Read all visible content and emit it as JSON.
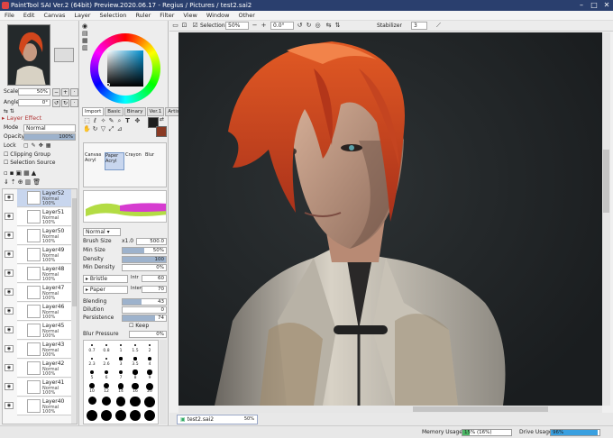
{
  "window": {
    "title": "PaintTool SAI Ver.2 (64bit) Preview.2020.06.17 - Regius / Pictures / test2.sai2"
  },
  "menu": [
    "File",
    "Edit",
    "Canvas",
    "Layer",
    "Selection",
    "Ruler",
    "Filter",
    "View",
    "Window",
    "Other"
  ],
  "navigator": {
    "scale_label": "Scale",
    "scale_value": "50%",
    "angle_label": "Angle",
    "angle_value": "0°"
  },
  "layer_effect": {
    "header": "Layer Effect",
    "mode_label": "Mode",
    "mode_value": "Normal",
    "opacity_label": "Opacity",
    "opacity_value": "100%",
    "lock_label": "Lock",
    "clipping_label": "Clipping Group",
    "selection_source_label": "Selection Source"
  },
  "layers": [
    {
      "name": "Layer52",
      "mode": "Normal",
      "opacity": "100%",
      "selected": true
    },
    {
      "name": "Layer51",
      "mode": "Normal",
      "opacity": "100%",
      "selected": false
    },
    {
      "name": "Layer50",
      "mode": "Normal",
      "opacity": "100%",
      "selected": false
    },
    {
      "name": "Layer49",
      "mode": "Normal",
      "opacity": "100%",
      "selected": false
    },
    {
      "name": "Layer48",
      "mode": "Normal",
      "opacity": "100%",
      "selected": false
    },
    {
      "name": "Layer47",
      "mode": "Normal",
      "opacity": "100%",
      "selected": false
    },
    {
      "name": "Layer46",
      "mode": "Normal",
      "opacity": "100%",
      "selected": false
    },
    {
      "name": "Layer45",
      "mode": "Normal",
      "opacity": "100%",
      "selected": false
    },
    {
      "name": "Layer43",
      "mode": "Normal",
      "opacity": "100%",
      "selected": false
    },
    {
      "name": "Layer42",
      "mode": "Normal",
      "opacity": "100%",
      "selected": false
    },
    {
      "name": "Layer41",
      "mode": "Normal",
      "opacity": "100%",
      "selected": false
    },
    {
      "name": "Layer40",
      "mode": "Normal",
      "opacity": "100%",
      "selected": false
    }
  ],
  "color": {
    "primary": "#1e1e1e",
    "secondary": "#8a3a24",
    "tabs": [
      "Import",
      "Basic",
      "Binary",
      "Ver.1",
      "Artistic"
    ]
  },
  "tools": [
    {
      "name": "Canvas Acryl",
      "label": "Canvas\nAcryl"
    },
    {
      "name": "Paper Acryl",
      "label": "Paper\nAcryl"
    },
    {
      "name": "Crayon",
      "label": "Crayon"
    },
    {
      "name": "Blur",
      "label": "Blur"
    }
  ],
  "brush": {
    "mode": "Normal",
    "size_label": "Brush Size",
    "size_multiplier": "x1.0",
    "size_value": "500.0",
    "min_size_label": "Min Size",
    "min_size_value": "50%",
    "density_label": "Density",
    "density_value": "100",
    "min_density_label": "Min Density",
    "min_density_value": "0%",
    "texture1_label": "Bristle",
    "texture1_sub": "Intr",
    "texture1_value": "60",
    "texture2_label": "Paper",
    "texture2_sub": "Intens",
    "texture2_value": "70",
    "blending_label": "Blending",
    "blending_value": "43",
    "dilution_label": "Dilution",
    "dilution_value": "0",
    "persistence_label": "Persistence",
    "persistence_value": "74",
    "keep_opacity_label": "Keep Opacity",
    "blur_pressure_label": "Blur Pressure",
    "blur_pressure_value": "0%"
  },
  "brush_sizes": [
    "0.7",
    "0.8",
    "1",
    "1.5",
    "2",
    "2.3",
    "2.6",
    "3",
    "3.5",
    "4",
    "5",
    "6",
    "7",
    "8",
    "9",
    "10",
    "12",
    "14",
    "16",
    "20",
    "25",
    "30",
    "35",
    "40",
    "50",
    "60",
    "70",
    "80",
    "100",
    "120"
  ],
  "toolbar": {
    "selection_label": "Selection",
    "zoom_value": "50%",
    "rotation_value": "0.0°",
    "stabilizer_label": "Stabilizer",
    "stabilizer_value": "3"
  },
  "document_tab": {
    "name": "test2.sai2",
    "zoom": "50%"
  },
  "status": {
    "memory_label": "Memory Usage",
    "memory_value": "15% (16%)",
    "memory_fraction": 0.15,
    "drive_label": "Drive Usage",
    "drive_value": "96%",
    "drive_fraction": 0.96
  }
}
